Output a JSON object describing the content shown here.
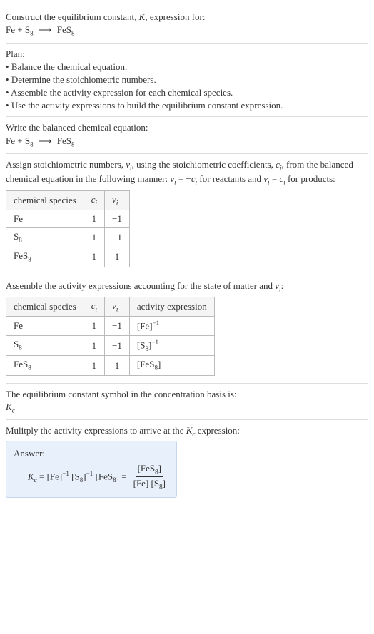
{
  "intro": {
    "line1": "Construct the equilibrium constant, ",
    "Ksym": "K",
    "line1b": ", expression for:",
    "eq_lhs": "Fe + S",
    "eq_s8_sub": "8",
    "arrow": "⟶",
    "eq_rhs": "FeS",
    "eq_fes8_sub": "8"
  },
  "plan": {
    "title": "Plan:",
    "items": [
      "Balance the chemical equation.",
      "Determine the stoichiometric numbers.",
      "Assemble the activity expression for each chemical species.",
      "Use the activity expressions to build the equilibrium constant expression."
    ]
  },
  "balanced": {
    "title": "Write the balanced chemical equation:",
    "lhs": "Fe + S",
    "s8sub": "8",
    "arrow": "⟶",
    "rhs": "FeS",
    "fes8sub": "8"
  },
  "stoich_intro": {
    "t1": "Assign stoichiometric numbers, ",
    "nu": "ν",
    "isub": "i",
    "t2": ", using the stoichiometric coefficients, ",
    "c": "c",
    "t3": ", from the balanced chemical equation in the following manner: ",
    "rel1a": "ν",
    "rel1b": " = −",
    "rel1c": "c",
    "t4": " for reactants and ",
    "rel2a": "ν",
    "rel2b": " = ",
    "rel2c": "c",
    "t5": " for products:"
  },
  "table1": {
    "h1": "chemical species",
    "h2a": "c",
    "h2b": "i",
    "h3a": "ν",
    "h3b": "i",
    "r1": {
      "sp": "Fe",
      "c": "1",
      "nu": "−1"
    },
    "r2": {
      "sp_a": "S",
      "sp_b": "8",
      "c": "1",
      "nu": "−1"
    },
    "r3": {
      "sp_a": "FeS",
      "sp_b": "8",
      "c": "1",
      "nu": "1"
    }
  },
  "activity_intro": {
    "t1": "Assemble the activity expressions accounting for the state of matter and ",
    "nu": "ν",
    "isub": "i",
    "t2": ":"
  },
  "table2": {
    "h1": "chemical species",
    "h2a": "c",
    "h2b": "i",
    "h3a": "ν",
    "h3b": "i",
    "h4": "activity expression",
    "r1": {
      "sp": "Fe",
      "c": "1",
      "nu": "−1",
      "act_a": "[Fe]",
      "act_sup": "−1"
    },
    "r2": {
      "sp_a": "S",
      "sp_b": "8",
      "c": "1",
      "nu": "−1",
      "act_a": "[S",
      "act_b": "8",
      "act_c": "]",
      "act_sup": "−1"
    },
    "r3": {
      "sp_a": "FeS",
      "sp_b": "8",
      "c": "1",
      "nu": "1",
      "act_a": "[FeS",
      "act_b": "8",
      "act_c": "]"
    }
  },
  "basis": {
    "t1": "The equilibrium constant symbol in the concentration basis is:",
    "Ksym": "K",
    "csub": "c"
  },
  "multiply": {
    "t1": "Mulitply the activity expressions to arrive at the ",
    "Ksym": "K",
    "csub": "c",
    "t2": " expression:"
  },
  "answer": {
    "label": "Answer:",
    "Ksym": "K",
    "csub": "c",
    "eq": " = ",
    "p1": "[Fe]",
    "sup1": "−1",
    "sp": " ",
    "p2a": "[S",
    "p2b": "8",
    "p2c": "]",
    "sup2": "−1",
    "p3a": "[FeS",
    "p3b": "8",
    "p3c": "]",
    "eq2": " = ",
    "num_a": "[FeS",
    "num_b": "8",
    "num_c": "]",
    "den_a": "[Fe] [S",
    "den_b": "8",
    "den_c": "]"
  }
}
